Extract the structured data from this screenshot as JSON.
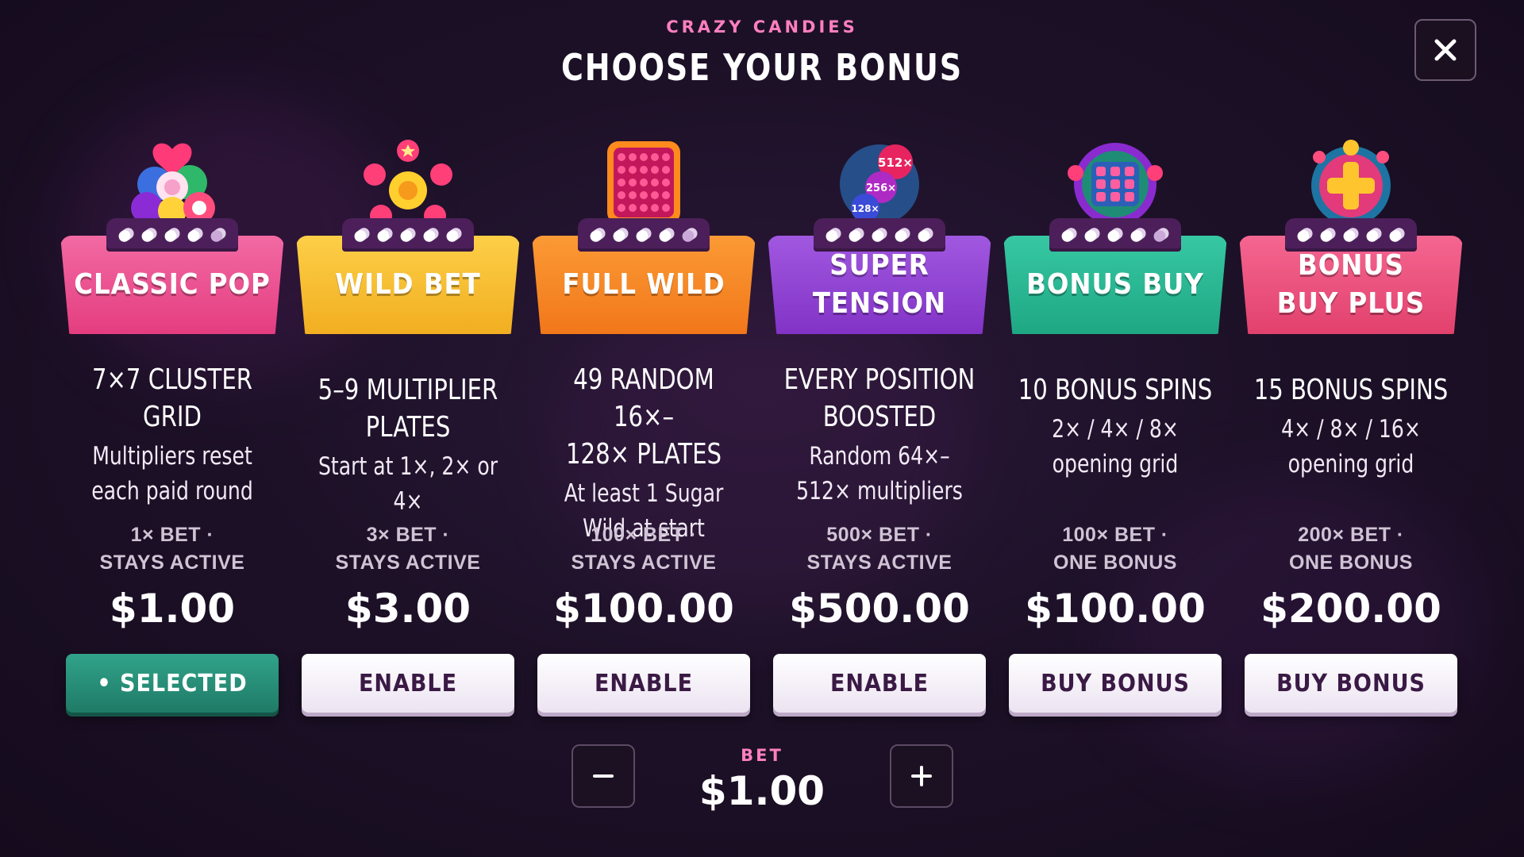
{
  "header": {
    "game_name": "CRAZY CANDIES",
    "title": "CHOOSE YOUR BONUS",
    "close_icon": "close-icon"
  },
  "cards": [
    {
      "label": "CLASSIC POP",
      "headline": "7×7 CLUSTER\nGRID",
      "description": "Multipliers reset\neach paid round",
      "cost_line": "1× BET ·\nSTAYS ACTIVE",
      "price": "$1.00",
      "action": "• SELECTED",
      "selected": true,
      "color": "#f0508f",
      "art_icon": "candy-pile-icon"
    },
    {
      "label": "WILD BET",
      "headline": "5–9 MULTIPLIER\nPLATES",
      "description": "Start at 1×, 2× or 4×",
      "cost_line": "3× BET ·\nSTAYS ACTIVE",
      "price": "$3.00",
      "action": "ENABLE",
      "selected": false,
      "color": "#f5b92d",
      "art_icon": "star-candies-icon"
    },
    {
      "label": "FULL WILD",
      "headline": "49 RANDOM 16×–\n128× PLATES",
      "description": "At least 1 Sugar\nWild at start",
      "cost_line": "100× BET ·\nSTAYS ACTIVE",
      "price": "$100.00",
      "action": "ENABLE",
      "selected": false,
      "color": "#f4821f",
      "art_icon": "candy-grid-icon"
    },
    {
      "label": "SUPER\nTENSION",
      "headline": "EVERY POSITION\nBOOSTED",
      "description": "Random 64×–\n512× multipliers",
      "cost_line": "500× BET ·\nSTAYS ACTIVE",
      "price": "$500.00",
      "action": "ENABLE",
      "selected": false,
      "color": "#8d3fd0",
      "art_icon": "multiplier-orbs-icon",
      "art_texts": [
        "512×",
        "256×",
        "128×"
      ]
    },
    {
      "label": "BONUS BUY",
      "headline": "10 BONUS SPINS",
      "description": "2× / 4× / 8×\nopening grid",
      "cost_line": "100× BET ·\nONE BONUS",
      "price": "$100.00",
      "action": "BUY BONUS",
      "selected": false,
      "color": "#25b28f",
      "art_icon": "wheel-grid-icon"
    },
    {
      "label": "BONUS\nBUY PLUS",
      "headline": "15 BONUS SPINS",
      "description": "4× / 8× / 16×\nopening grid",
      "cost_line": "200× BET ·\nONE BONUS",
      "price": "$200.00",
      "action": "BUY BONUS",
      "selected": false,
      "color": "#ec4e79",
      "art_icon": "golden-cross-icon"
    }
  ],
  "bet": {
    "label": "BET",
    "value": "$1.00",
    "decrease_icon": "minus-icon",
    "increase_icon": "plus-icon"
  }
}
